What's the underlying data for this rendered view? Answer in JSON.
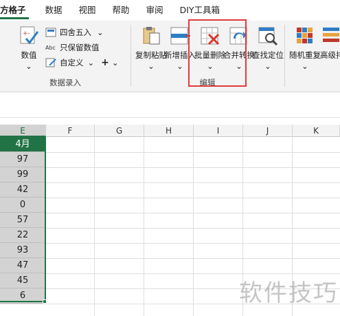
{
  "menu": {
    "tabs": [
      "方格子",
      "数据",
      "视图",
      "帮助",
      "审阅",
      "DIY工具箱"
    ]
  },
  "ribbon": {
    "group_numbers": {
      "label": "数据录入",
      "number_button": "数值",
      "round_button": "四舍五入",
      "keep_value_button": "只保留数值",
      "custom_button": "自定义"
    },
    "group_edit": {
      "label": "编辑",
      "copy_paste": "复制粘贴",
      "insert": "新增插入",
      "batch_delete": "批量删除",
      "merge_convert": "合并转换",
      "find_locate": "查找定位"
    },
    "group_random": {
      "random_repeat": "随机重复",
      "advanced_sort": "高级排序"
    }
  },
  "sheet": {
    "columns": [
      "E",
      "F",
      "G",
      "H",
      "I",
      "J",
      "K"
    ],
    "column_e_values": [
      "4月",
      "97",
      "99",
      "42",
      "0",
      "57",
      "22",
      "93",
      "47",
      "45",
      "6"
    ]
  },
  "watermark": "软件技巧",
  "colors": {
    "accent": "#217346",
    "highlight": "#e03a3a",
    "selection": "#d3d3d3"
  }
}
